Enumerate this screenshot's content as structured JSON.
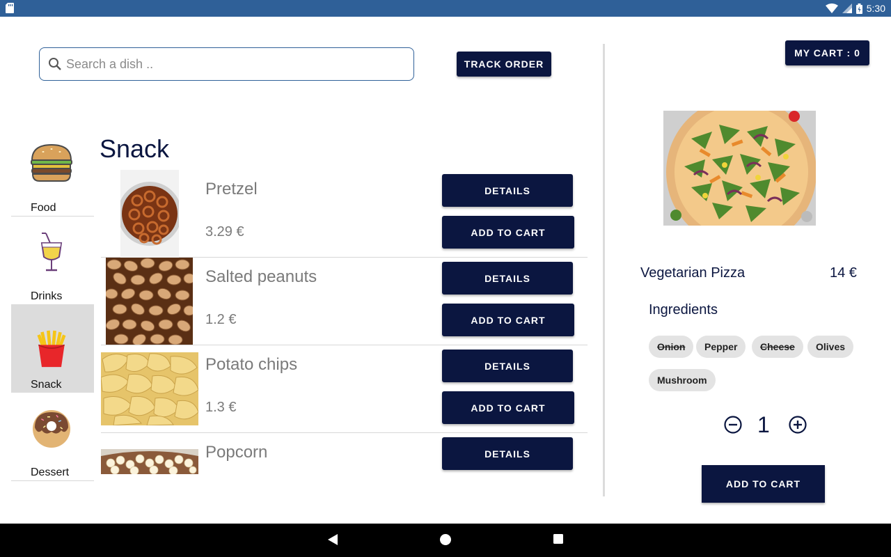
{
  "status_bar": {
    "time": "5:30",
    "bg": "#2f6098"
  },
  "search": {
    "placeholder": "Search a dish .."
  },
  "header": {
    "track_order": "TRACK ORDER",
    "my_cart": "MY CART : 0"
  },
  "categories": [
    {
      "label": "Food",
      "icon": "burger-icon"
    },
    {
      "label": "Drinks",
      "icon": "drink-icon"
    },
    {
      "label": "Snack",
      "icon": "fries-icon",
      "active": true
    },
    {
      "label": "Dessert",
      "icon": "donut-icon"
    }
  ],
  "section_title": "Snack",
  "items": [
    {
      "name": "Pretzel",
      "price": "3.29 €",
      "details": "DETAILS",
      "add": "ADD TO CART"
    },
    {
      "name": "Salted peanuts",
      "price": "1.2 €",
      "details": "DETAILS",
      "add": "ADD TO CART"
    },
    {
      "name": "Potato chips",
      "price": "1.3 €",
      "details": "DETAILS",
      "add": "ADD TO CART"
    },
    {
      "name": "Popcorn",
      "details": "DETAILS"
    }
  ],
  "detail": {
    "name": "Vegetarian Pizza",
    "price": "14 €",
    "ingredients_title": "Ingredients",
    "ingredients": [
      {
        "label": "Onion",
        "removed": true
      },
      {
        "label": "Pepper",
        "removed": false
      },
      {
        "label": "Cheese",
        "removed": true
      },
      {
        "label": "Olives",
        "removed": false
      },
      {
        "label": "Mushroom",
        "removed": false
      }
    ],
    "quantity": "1",
    "add": "ADD TO CART"
  },
  "colors": {
    "primary": "#0b1640",
    "accent": "#2f6098"
  }
}
